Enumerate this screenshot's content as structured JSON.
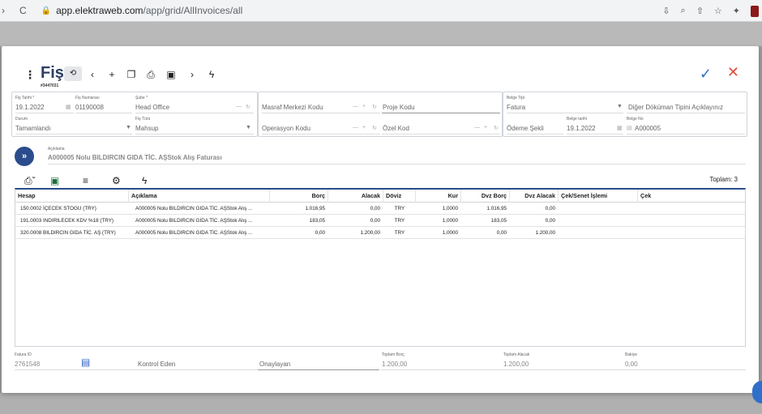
{
  "browser": {
    "url_host": "app.elektraweb.com",
    "url_path": "/app/grid/AllInvoices/all",
    "back_icon": "back-arrow-icon",
    "reload_icon": "reload-icon",
    "lock_icon": "lock-icon"
  },
  "header": {
    "title": "Fiş",
    "doc_number": "#3447031",
    "accent": "#2b4c8c",
    "confirm_color": "#2f6fc9",
    "cancel_color": "#e24b3b"
  },
  "form": {
    "fis_tarihi_label": "Fiş Tarihi *",
    "fis_tarihi": "19.1.2022",
    "fis_numarasi_label": "Fiş Numarası",
    "fis_numarasi": "01190008",
    "sube_label": "Şube *",
    "sube": "Head Office",
    "durum_label": "Durum",
    "durum": "Tamamlandı",
    "fis_turu_label": "Fiş Türü",
    "fis_turu": "Mahsup",
    "masraf_merkezi": "Masraf Merkezi Kodu",
    "proje_kodu": "Proje Kodu",
    "operasyon_kodu": "Operasyon Kodu",
    "ozel_kod": "Özel Kod",
    "belge_tipi_label": "Belge Tipi",
    "belge_tipi": "Fatura",
    "dokuman_tipi": "Diğer Döküman Tipini Açıklayınız",
    "odeme_sekli": "Ödeme Şekli",
    "belge_tarihi_label": "Belge tarihi",
    "belge_tarihi": "19.1.2022",
    "belge_no_label": "Belge No",
    "belge_no": "A000005",
    "aciklama_label": "Açıklama",
    "aciklama": "A000005 Nolu BILDIRCIN GIDA TİC. AŞStok Alış Faturası"
  },
  "grid": {
    "total": "Toplam: 3",
    "columns": [
      "Hesap",
      "Açıklama",
      "Borç",
      "Alacak",
      "Döviz",
      "Kur",
      "Dvz Borç",
      "Dvz Alacak",
      "Çek/Senet İşlemi",
      "Çek"
    ],
    "rows": [
      [
        "150.0002 İÇECEK STOGU (TRY)",
        "A000005 Nolu BILDIRCIN GIDA TİC. AŞStok Alış ...",
        "1.016,95",
        "0,00",
        "TRY",
        "1,0000",
        "1.016,95",
        "0,00",
        "",
        ""
      ],
      [
        "191.0003 INDIRILECEK KDV %18 (TRY)",
        "A000005 Nolu BILDIRCIN GIDA TİC. AŞStok Alış ...",
        "183,05",
        "0,00",
        "TRY",
        "1,0000",
        "183,05",
        "0,00",
        "",
        ""
      ],
      [
        "320.0008 BILDIRCIN GIDA TİC. AŞ (TRY)",
        "A000005 Nolu BILDIRCIN GIDA TİC. AŞStok Alış ...",
        "0,00",
        "1.200,00",
        "TRY",
        "1,0000",
        "0,00",
        "1.200,00",
        "",
        ""
      ]
    ]
  },
  "footer": {
    "fatura_id_label": "Fatura ID",
    "fatura_id": "2761548",
    "kontrol_eden": "Kontrol Eden",
    "onaylayan": "Onaylayan",
    "toplam_borc_label": "Toplam Borç",
    "toplam_borc": "1.200,00",
    "toplam_alacak_label": "Toplam Alacak",
    "toplam_alacak": "1.200,00",
    "bakiye_label": "Bakiye",
    "bakiye": "0,00"
  }
}
